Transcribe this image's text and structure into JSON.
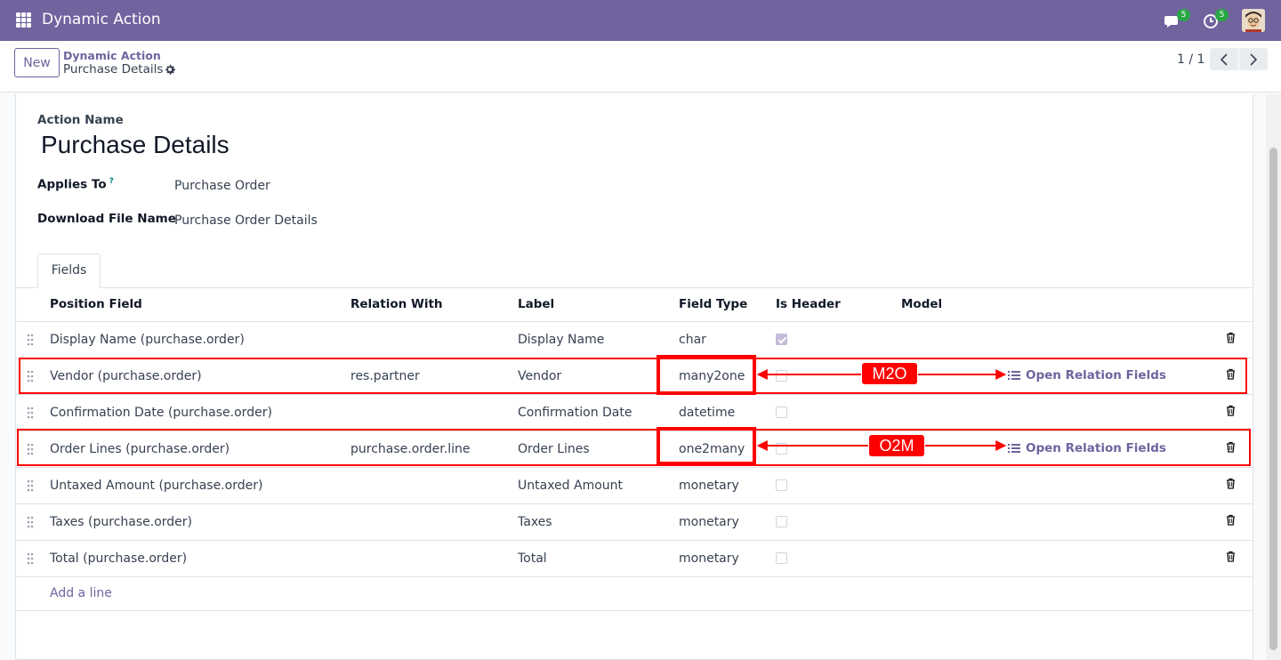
{
  "app": {
    "title": "Dynamic Action"
  },
  "navbar": {
    "messages_badge": "5",
    "activities_badge": "5",
    "icons": [
      "apps-grid-icon",
      "chat-icon",
      "clock-icon",
      "avatar"
    ]
  },
  "control_panel": {
    "new_button": "New",
    "breadcrumb_parent": "Dynamic Action",
    "breadcrumb_current": "Purchase Details",
    "pager": "1 / 1"
  },
  "form": {
    "action_name_label": "Action Name",
    "action_name": "Purchase Details",
    "applies_to_label": "Applies To",
    "applies_to_tooltip": "?",
    "applies_to": "Purchase Order",
    "download_file_label": "Download File Name",
    "download_file": "Purchase Order Details"
  },
  "tabs": [
    {
      "label": "Fields"
    }
  ],
  "table": {
    "columns": [
      "Position Field",
      "Relation With",
      "Label",
      "Field Type",
      "Is Header",
      "Model"
    ],
    "rows": [
      {
        "position_field": "Display Name (purchase.order)",
        "relation_with": "",
        "label": "Display Name",
        "field_type": "char",
        "is_header": true,
        "model": ""
      },
      {
        "position_field": "Vendor (purchase.order)",
        "relation_with": "res.partner",
        "label": "Vendor",
        "field_type": "many2one",
        "is_header": false,
        "model": "Open Relation Fields"
      },
      {
        "position_field": "Confirmation Date (purchase.order)",
        "relation_with": "",
        "label": "Confirmation Date",
        "field_type": "datetime",
        "is_header": false,
        "model": ""
      },
      {
        "position_field": "Order Lines (purchase.order)",
        "relation_with": "purchase.order.line",
        "label": "Order Lines",
        "field_type": "one2many",
        "is_header": false,
        "model": "Open Relation Fields"
      },
      {
        "position_field": "Untaxed Amount (purchase.order)",
        "relation_with": "",
        "label": "Untaxed Amount",
        "field_type": "monetary",
        "is_header": false,
        "model": ""
      },
      {
        "position_field": "Taxes (purchase.order)",
        "relation_with": "",
        "label": "Taxes",
        "field_type": "monetary",
        "is_header": false,
        "model": ""
      },
      {
        "position_field": "Total (purchase.order)",
        "relation_with": "",
        "label": "Total",
        "field_type": "monetary",
        "is_header": false,
        "model": ""
      }
    ],
    "add_line": "Add a line"
  },
  "annotations": {
    "m2o_tag": "M2O",
    "o2m_tag": "O2M",
    "color": "#ff0000"
  },
  "colors": {
    "brand": "#71639e",
    "badge": "#28a745"
  }
}
